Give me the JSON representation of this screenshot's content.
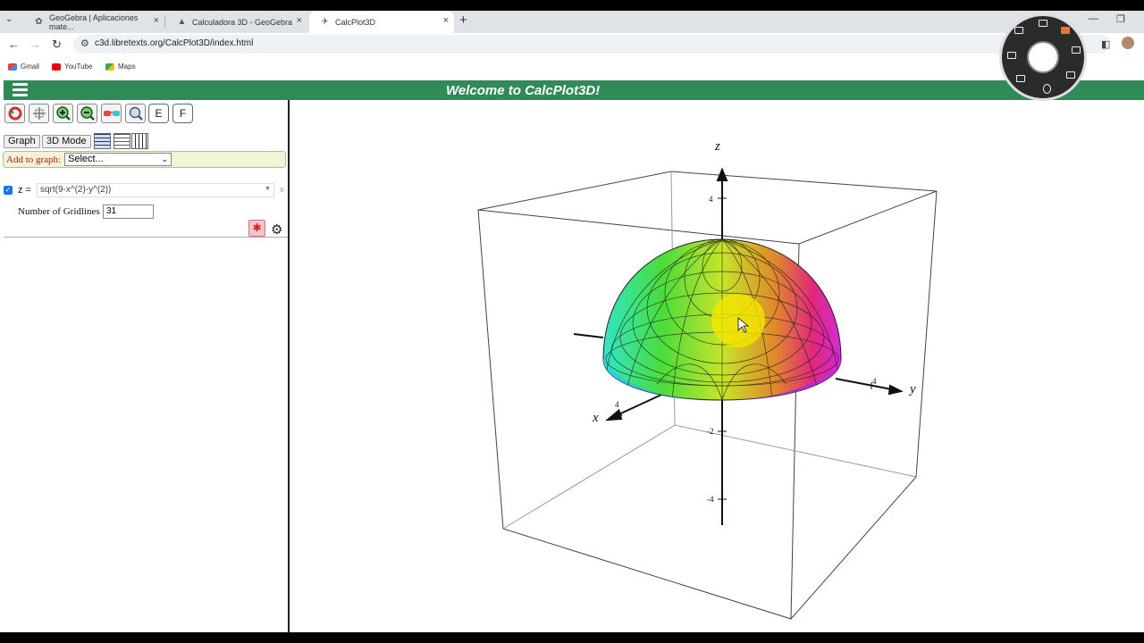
{
  "browser": {
    "tabs": [
      {
        "label": "GeoGebra | Aplicaciones mate...",
        "close": "×"
      },
      {
        "label": "Calculadora 3D - GeoGebra",
        "close": "×"
      },
      {
        "label": "CalcPlot3D",
        "close": "×"
      }
    ],
    "new_tab": "+",
    "url": "c3d.libretexts.org/CalcPlot3D/index.html",
    "bookmarks": [
      "Gmail",
      "YouTube",
      "Maps"
    ]
  },
  "app": {
    "title": "Welcome to CalcPlot3D!"
  },
  "toolbar": {
    "e_label": "E",
    "f_label": "F",
    "graph_label": "Graph",
    "mode_label": "3D Mode"
  },
  "add_to_graph": {
    "label": "Add to graph:",
    "selected": "Select..."
  },
  "function": {
    "checked": true,
    "lhs": "z =",
    "expression": "sqrt(9-x^(2)-y^(2))",
    "remove": "x",
    "gridlines_label": "Number of Gridlines",
    "gridlines_value": "31"
  },
  "plot": {
    "axis_labels": {
      "x": "x",
      "y": "y",
      "z": "z"
    },
    "ticks": {
      "z_pos": "4",
      "z_neg2": "-2",
      "z_neg4": "-4",
      "y_pos": "4",
      "x_pos": "4"
    }
  }
}
